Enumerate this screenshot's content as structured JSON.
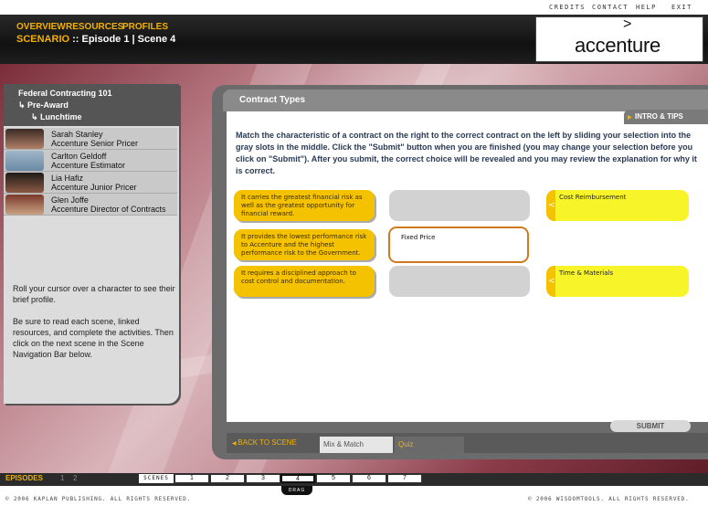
{
  "util_links": [
    "CREDITS",
    "CONTACT",
    "HELP",
    "EXIT"
  ],
  "nav": [
    "OVERVIEW",
    "RESOURCES",
    "PROFILES"
  ],
  "scenario": {
    "label": "SCENARIO",
    "rest": " :: Episode 1 | Scene 4"
  },
  "logo": {
    "text": "accenture",
    "mark": ">"
  },
  "breadcrumb": [
    "Federal Contracting 101",
    "↳ Pre-Award",
    "↳ Lunchtime"
  ],
  "characters": [
    {
      "name": "Sarah Stanley",
      "role": "Accenture Senior Pricer"
    },
    {
      "name": "Carlton Geldoff",
      "role": "Accenture Estimator"
    },
    {
      "name": "Lia Hafiz",
      "role": "Accenture Junior Pricer"
    },
    {
      "name": "Glen Joffe",
      "role": "Accenture Director of Contracts"
    }
  ],
  "help": {
    "p1": "Roll your cursor over a character to see their brief profile.",
    "p2": "Be sure to read each scene, linked resources, and complete the activities. Then click on the next scene in the Scene Navigation Bar below."
  },
  "main": {
    "title": "Contract Types",
    "intro_tips": "INTRO & TIPS",
    "instructions": "Match the characteristic of a contract on the right to the correct contract on the left by sliding your selection into the gray slots in the middle. Click the \"Submit\" button when you are finished (you may change your selection before you click on \"Submit\"). After you submit, the correct choice will be revealed and you may review the explanation for why it is correct.",
    "left_items": [
      "It carries the greatest financial risk as well as the greatest opportunity for financial reward.",
      "It provides the lowest performance risk to Accenture and the highest performance risk to the Government.",
      "It requires a disciplined approach to cost control and documentation."
    ],
    "slot_filled": "Fixed Price",
    "right_items": [
      "Cost Reimbursement",
      "Time & Materials"
    ],
    "submit": "SUBMIT",
    "back": "BACK TO SCENE",
    "tab_mix": "Mix & Match",
    "tab_quiz": "Quiz"
  },
  "bottom": {
    "episodes": "EPISODES",
    "episode_nums": [
      "1",
      "2"
    ],
    "scenes_label": "SCENES",
    "scenes": [
      "1",
      "2",
      "3",
      "4",
      "5",
      "6",
      "7"
    ],
    "active_scene": "4",
    "drag": "DRAG"
  },
  "footer": {
    "left": "© 2006 KAPLAN PUBLISHING. ALL RIGHTS RESERVED.",
    "right": "© 2006 WISDOMTOOLS. ALL RIGHTS RESERVED."
  },
  "colors": {
    "accent": "#f2b100",
    "panel": "#6b6b6b",
    "left_pill": "#f5c200",
    "right_pill": "#f7f52a",
    "slot_border": "#d07a20"
  }
}
